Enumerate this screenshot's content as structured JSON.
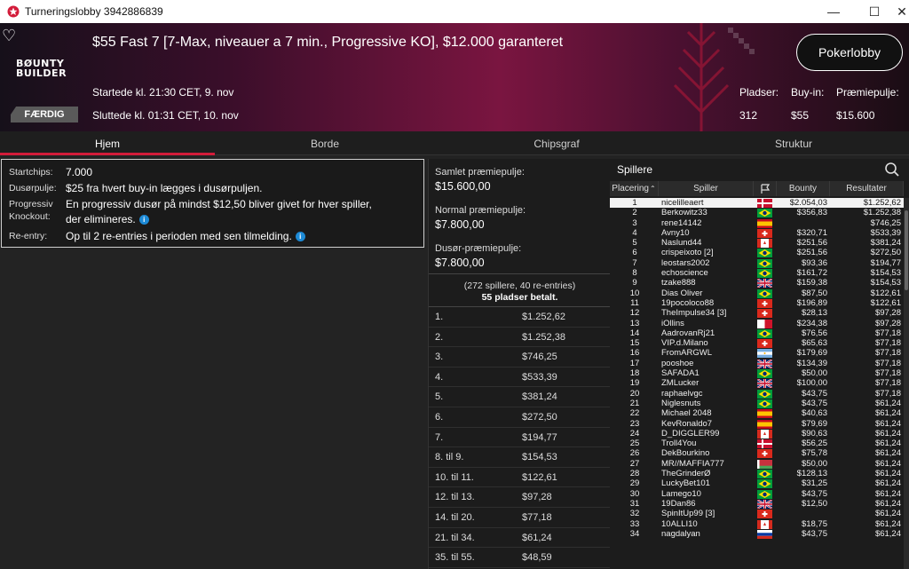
{
  "window": {
    "title": "Turneringslobby 3942886839"
  },
  "header": {
    "title": "$55 Fast 7 [7-Max, niveauer a 7 min., Progressive KO], $12.000 garanteret",
    "brand_line1": "BØUNTY",
    "brand_line2": "BUILDER",
    "started": "Startede kl. 21:30 CET, 9. nov",
    "ended": "Sluttede kl. 01:31 CET, 10. nov",
    "status": "FÆRDIG",
    "lobby_button": "Pokerlobby",
    "stats": {
      "seats_label": "Pladser:",
      "seats": "312",
      "buyin_label": "Buy-in:",
      "buyin": "$55",
      "pool_label": "Præmiepulje:",
      "pool": "$15.600"
    }
  },
  "tabs": [
    "Hjem",
    "Borde",
    "Chipsgraf",
    "Struktur"
  ],
  "info": {
    "startchips_label": "Startchips:",
    "startchips": "7.000",
    "bountypool_label": "Dusørpulje:",
    "bountypool": "$25 fra hvert buy-in lægges i dusørpuljen.",
    "pko_label1": "Progressiv",
    "pko_label2": "Knockout:",
    "pko_line1": "En progressiv dusør på mindst $12,50 bliver givet for hver spiller,",
    "pko_line2": "der elimineres.",
    "reentry_label": "Re-entry:",
    "reentry": "Op til 2 re-entries i perioden med sen tilmelding."
  },
  "prize": {
    "total_label": "Samlet præmiepulje:",
    "total": "$15.600,00",
    "normal_label": "Normal præmiepulje:",
    "normal": "$7.800,00",
    "bounty_label": "Dusør-præmiepulje:",
    "bounty": "$7.800,00",
    "summary": "(272 spillere, 40 re-entries)",
    "paid": "55 pladser betalt.",
    "payouts": [
      [
        "1.",
        "$1.252,62"
      ],
      [
        "2.",
        "$1.252,38"
      ],
      [
        "3.",
        "$746,25"
      ],
      [
        "4.",
        "$533,39"
      ],
      [
        "5.",
        "$381,24"
      ],
      [
        "6.",
        "$272,50"
      ],
      [
        "7.",
        "$194,77"
      ],
      [
        "8. til 9.",
        "$154,53"
      ],
      [
        "10. til 11.",
        "$122,61"
      ],
      [
        "12. til 13.",
        "$97,28"
      ],
      [
        "14. til 20.",
        "$77,18"
      ],
      [
        "21. til 34.",
        "$61,24"
      ],
      [
        "35. til 55.",
        "$48,59"
      ]
    ]
  },
  "players": {
    "title": "Spillere",
    "columns": [
      "Placering",
      "Spiller",
      "Bounty",
      "Resultater"
    ],
    "rows": [
      [
        "1",
        "nicelilleaert",
        "$2.054,03",
        "$1.252,62",
        "dk"
      ],
      [
        "2",
        "Berkowitz33",
        "$356,83",
        "$1.252,38",
        "br"
      ],
      [
        "3",
        "rene14142",
        "",
        "$746,25",
        "es"
      ],
      [
        "4",
        "Avny10",
        "$320,71",
        "$533,39",
        "ch"
      ],
      [
        "5",
        "Naslund44",
        "$251,56",
        "$381,24",
        "ca"
      ],
      [
        "6",
        "crispeixoto [2]",
        "$251,56",
        "$272,50",
        "br"
      ],
      [
        "7",
        "leostars2002",
        "$93,36",
        "$194,77",
        "br"
      ],
      [
        "8",
        "echoscience",
        "$161,72",
        "$154,53",
        "br"
      ],
      [
        "9",
        "tzake888",
        "$159,38",
        "$154,53",
        "gb"
      ],
      [
        "10",
        "Dias Oliver",
        "$87,50",
        "$122,61",
        "br"
      ],
      [
        "11",
        "19pocoloco88",
        "$196,89",
        "$122,61",
        "ch"
      ],
      [
        "12",
        "TheImpulse34 [3]",
        "$28,13",
        "$97,28",
        "ch"
      ],
      [
        "13",
        "iOllins",
        "$234,38",
        "$97,28",
        "mt"
      ],
      [
        "14",
        "AadrovanRj21",
        "$76,56",
        "$77,18",
        "br"
      ],
      [
        "15",
        "VIP.d.Milano",
        "$65,63",
        "$77,18",
        "ch"
      ],
      [
        "16",
        "FromARGWL",
        "$179,69",
        "$77,18",
        "ar"
      ],
      [
        "17",
        "pooshoe",
        "$134,39",
        "$77,18",
        "gb"
      ],
      [
        "18",
        "SAFADA1",
        "$50,00",
        "$77,18",
        "br"
      ],
      [
        "19",
        "ZMLucker",
        "$100,00",
        "$77,18",
        "gb"
      ],
      [
        "20",
        "raphaelvgc",
        "$43,75",
        "$77,18",
        "br"
      ],
      [
        "21",
        "Niglesnuts",
        "$43,75",
        "$61,24",
        "br"
      ],
      [
        "22",
        "Michael 2048",
        "$40,63",
        "$61,24",
        "es"
      ],
      [
        "23",
        "KevRonaldo7",
        "$79,69",
        "$61,24",
        "es"
      ],
      [
        "24",
        "D_DIGGLER99",
        "$90,63",
        "$61,24",
        "ca"
      ],
      [
        "25",
        "Troll4You",
        "$56,25",
        "$61,24",
        "dk"
      ],
      [
        "26",
        "DekBourkino",
        "$75,78",
        "$61,24",
        "ch"
      ],
      [
        "27",
        "MR//MAFFIA777",
        "$50,00",
        "$61,24",
        "by"
      ],
      [
        "28",
        "TheGrinderØ",
        "$128,13",
        "$61,24",
        "br"
      ],
      [
        "29",
        "LuckyBet101",
        "$31,25",
        "$61,24",
        "br"
      ],
      [
        "30",
        "Lamego10",
        "$43,75",
        "$61,24",
        "br"
      ],
      [
        "31",
        "19Dan86",
        "$12,50",
        "$61,24",
        "gb"
      ],
      [
        "32",
        "SpinItUp99 [3]",
        "",
        "$61,24",
        "ch"
      ],
      [
        "33",
        "10ALLI10",
        "$18,75",
        "$61,24",
        "ca"
      ],
      [
        "34",
        "nagdalyan",
        "$43,75",
        "$61,24",
        "ru"
      ]
    ]
  },
  "colors": {
    "accent": "#d31c3a",
    "info_icon": "#1d8ad6"
  }
}
